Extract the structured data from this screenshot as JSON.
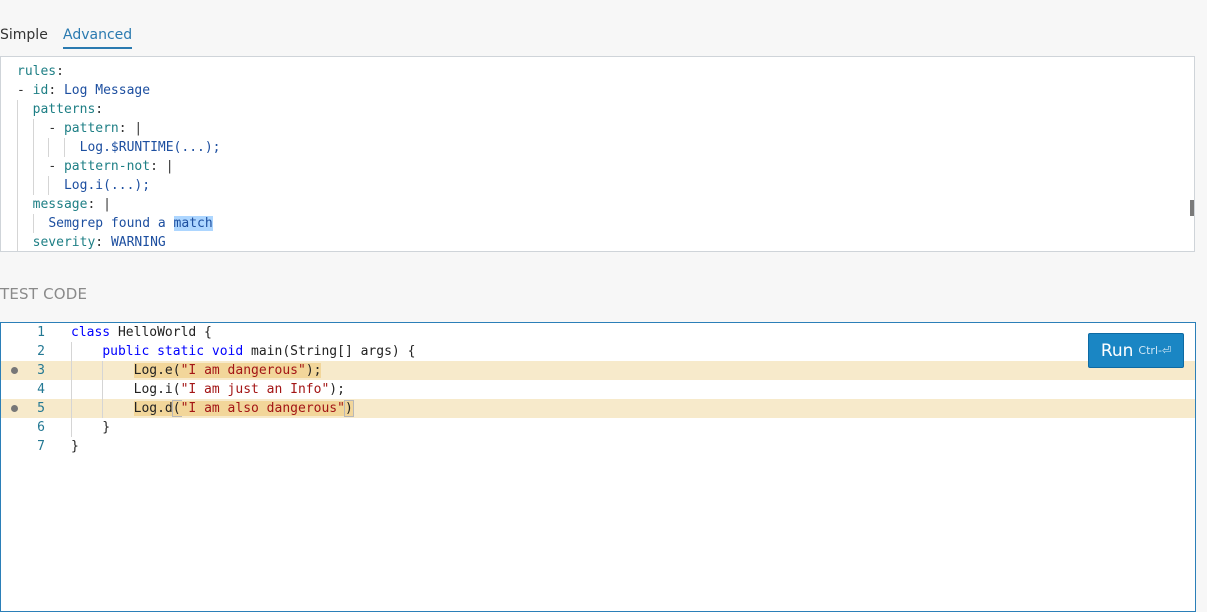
{
  "tabs": {
    "simple": "Simple",
    "advanced": "Advanced",
    "active": "Advanced"
  },
  "rule_editor": {
    "lines": [
      {
        "indent": 0,
        "tokens": [
          [
            "k",
            "rules"
          ],
          [
            "p",
            ":"
          ]
        ]
      },
      {
        "indent": 0,
        "tokens": [
          [
            "p",
            "- "
          ],
          [
            "k",
            "id"
          ],
          [
            "p",
            ": "
          ],
          [
            "v",
            "Log Message"
          ]
        ]
      },
      {
        "indent": 1,
        "tokens": [
          [
            "k",
            "patterns"
          ],
          [
            "p",
            ":"
          ]
        ]
      },
      {
        "indent": 2,
        "tokens": [
          [
            "p",
            "- "
          ],
          [
            "k",
            "pattern"
          ],
          [
            "p",
            ": |"
          ]
        ]
      },
      {
        "indent": 4,
        "tokens": [
          [
            "v",
            "Log.$RUNTIME(...);"
          ]
        ]
      },
      {
        "indent": 2,
        "tokens": [
          [
            "p",
            "- "
          ],
          [
            "k",
            "pattern-not"
          ],
          [
            "p",
            ": |"
          ]
        ]
      },
      {
        "indent": 3,
        "tokens": [
          [
            "v",
            "Log.i(...);"
          ]
        ]
      },
      {
        "indent": 1,
        "tokens": [
          [
            "k",
            "message"
          ],
          [
            "p",
            ": |"
          ]
        ]
      },
      {
        "indent": 2,
        "tokens": [
          [
            "v",
            "Semgrep found a "
          ],
          [
            "vh",
            "match"
          ]
        ]
      },
      {
        "indent": 1,
        "tokens": [
          [
            "k",
            "severity"
          ],
          [
            "p",
            ": "
          ],
          [
            "v",
            "WARNING"
          ]
        ]
      }
    ]
  },
  "test_code": {
    "title": "TEST CODE",
    "lines": [
      {
        "num": "1",
        "match": false,
        "tokens": [
          [
            "kw",
            "class"
          ],
          [
            "tx",
            " HelloWorld {"
          ]
        ]
      },
      {
        "num": "2",
        "match": false,
        "tokens": [
          [
            "tx",
            "    "
          ],
          [
            "kw",
            "public static void"
          ],
          [
            "tx",
            " main(String[] args) {"
          ]
        ]
      },
      {
        "num": "3",
        "match": true,
        "tokens": [
          [
            "tx",
            "        "
          ],
          [
            "m",
            "Log.e("
          ],
          [
            "ms",
            "\"I am dangerous\""
          ],
          [
            "m",
            ");"
          ]
        ]
      },
      {
        "num": "4",
        "match": false,
        "tokens": [
          [
            "tx",
            "        Log.i("
          ],
          [
            "str",
            "\"I am just an Info\""
          ],
          [
            "tx",
            ");"
          ]
        ]
      },
      {
        "num": "5",
        "match": true,
        "tokens": [
          [
            "tx",
            "        "
          ],
          [
            "m",
            "Log.d"
          ],
          [
            "mb",
            "("
          ],
          [
            "ms",
            "\"I am also dangerous\""
          ],
          [
            "mb",
            ")"
          ]
        ]
      },
      {
        "num": "6",
        "match": false,
        "tokens": [
          [
            "tx",
            "    }"
          ]
        ]
      },
      {
        "num": "7",
        "match": false,
        "tokens": [
          [
            "tx",
            "}"
          ]
        ]
      }
    ]
  },
  "run_button": {
    "label": "Run",
    "shortcut": "Ctrl-⏎"
  },
  "colors": {
    "accent": "#1a86c4",
    "match_highlight": "#f7eacb",
    "tab_active": "#2a7ab0"
  }
}
